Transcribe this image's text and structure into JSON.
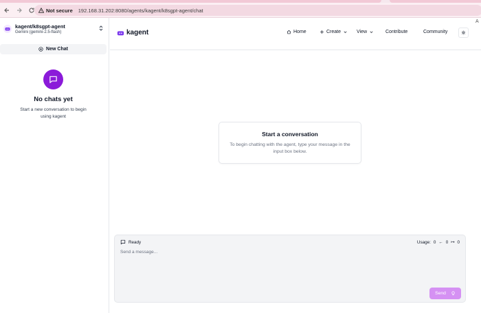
{
  "browser": {
    "security_label": "Not secure",
    "url": "192.168.31.202:8080/agents/kagent/k8sgpt-agent/chat",
    "side_letter": "A"
  },
  "sidebar": {
    "agent_name": "kagent/k8sgpt-agent",
    "agent_model": "Gemini (gemini-2.5-flash)",
    "new_chat_label": "New Chat",
    "empty_title": "No chats yet",
    "empty_desc": "Start a new conversation to begin using kagent"
  },
  "header": {
    "brand": "kagent",
    "nav": {
      "home": "Home",
      "create": "Create",
      "view": "View",
      "contribute": "Contribute",
      "community": "Community"
    }
  },
  "main": {
    "card_title": "Start a conversation",
    "card_desc": "To begin chatting with the agent, type your message in the input box below."
  },
  "composer": {
    "status": "Ready",
    "usage_label": "Usage:",
    "usage_total": "0",
    "usage_in": "0",
    "usage_out": "0",
    "placeholder": "Send a message...",
    "send_label": "Send"
  },
  "colors": {
    "accent": "#8b1ad9",
    "send_button": "#d591f3",
    "browser_bar": "#fbeff3"
  }
}
